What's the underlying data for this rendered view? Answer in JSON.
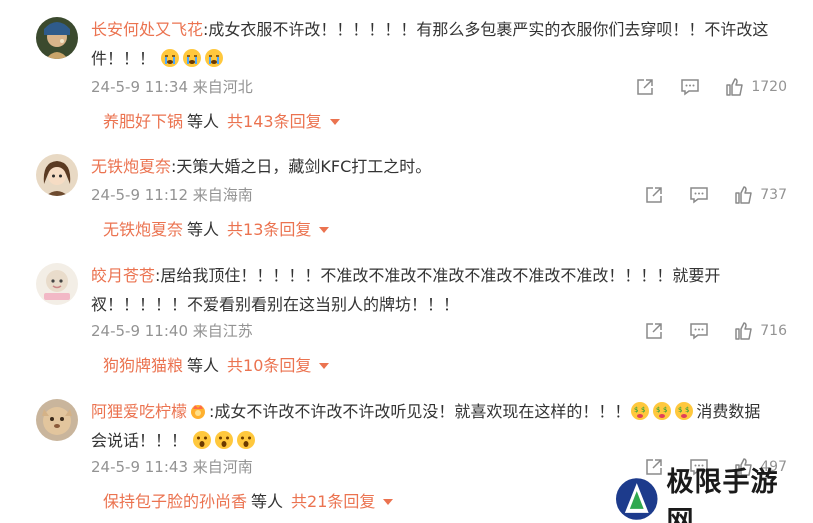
{
  "colors": {
    "accent": "#eb7350",
    "muted": "#939393",
    "text": "#333333"
  },
  "icons": {
    "share": "share-icon",
    "comment": "comment-icon",
    "like": "thumbs-up-icon",
    "expand": "caret-down-icon"
  },
  "comments": [
    {
      "user": "长安何处又飞花",
      "text_line1": ":成女衣服不许改！！！！！！有那么多包裹严实的衣服你们去穿呗！！不许改这",
      "text_line2": "件！！！",
      "time": "24-5-9 11:34 来自河北",
      "likes": "1720",
      "reply_user": "养肥好下锅",
      "reply_mid": "等人",
      "reply_more": "共143条回复"
    },
    {
      "user": "无铁炮夏奈",
      "text_line1": ":天策大婚之日，藏剑KFC打工之时。",
      "time": "24-5-9 11:12 来自海南",
      "likes": "737",
      "reply_user": "无铁炮夏奈",
      "reply_mid": "等人",
      "reply_more": "共13条回复"
    },
    {
      "user": "皎月苍苍",
      "text_line1": ":居给我顶住！！！！！不准改不准改不准改不准改不准改不准改！！！！就要开",
      "text_line2": "衩！！！！！不爱看别看别在这当别人的牌坊！！！",
      "time": "24-5-9 11:40 来自江苏",
      "likes": "716",
      "reply_user": "狗狗牌猫粮",
      "reply_mid": "等人",
      "reply_more": "共10条回复"
    },
    {
      "user": "阿狸爱吃柠檬",
      "text_line1": ":成女不许改不许改不许改听见没！就喜欢现在这样的！！！",
      "text_line1b": "消费数据",
      "text_line2": "会说话！！！",
      "time": "24-5-9 11:43 来自河南",
      "likes": "497",
      "reply_user": "保持包子脸的孙尚香",
      "reply_mid": "等人",
      "reply_more": "共21条回复"
    }
  ],
  "watermark": {
    "text": "极限手游网"
  }
}
